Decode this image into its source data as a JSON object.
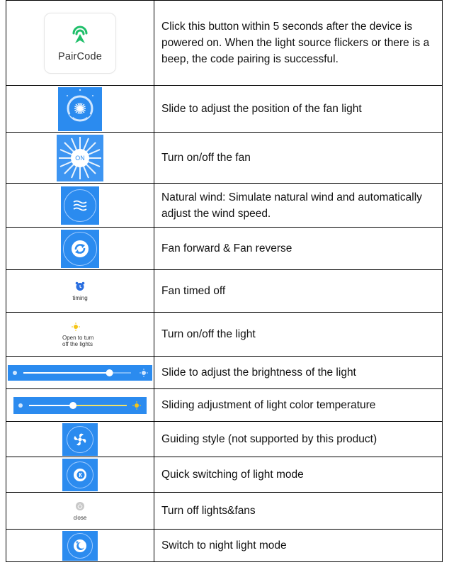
{
  "rows": [
    {
      "icon_label": "PairCode",
      "description": "Click this button within 5 seconds after the device is powered on. When the light source flickers or there is a beep, the code pairing is successful."
    },
    {
      "icon_label": "",
      "description": "Slide to adjust the position of the fan light"
    },
    {
      "icon_label": "ON",
      "description": "Turn on/off the fan"
    },
    {
      "icon_label": "",
      "description": "Natural wind: Simulate natural wind and automatically adjust the wind speed."
    },
    {
      "icon_label": "",
      "description": "Fan forward & Fan reverse"
    },
    {
      "icon_label": "timing",
      "description": "Fan timed off"
    },
    {
      "icon_label": "Open to turn off the lights",
      "description": "Turn on/off the light"
    },
    {
      "icon_label": "",
      "description": "Slide to adjust the brightness of the light",
      "slider_level": 0.8
    },
    {
      "icon_label": "",
      "description": "Sliding adjustment of light color temperature",
      "slider_level": 0.45
    },
    {
      "icon_label": "",
      "description": "Guiding style (not supported by this product)"
    },
    {
      "icon_label": "",
      "description": "Quick switching of light mode"
    },
    {
      "icon_label": "close",
      "description": "Turn off lights&fans"
    },
    {
      "icon_label": "",
      "description": "Switch to night light mode"
    }
  ],
  "icons": [
    "paircode-icon",
    "fan-light-dial-icon",
    "fan-on-icon",
    "natural-wind-icon",
    "fan-direction-icon",
    "timing-alarm-icon",
    "light-bulb-icon",
    "brightness-slider-icon",
    "color-temp-slider-icon",
    "guiding-fan-icon",
    "light-mode-k-icon",
    "power-close-icon",
    "night-moon-icon"
  ],
  "colors": {
    "accent_blue": "#2b8bef",
    "pair_green": "#1fbf6a",
    "sun_yellow": "#f5c518",
    "border": "#000000"
  }
}
